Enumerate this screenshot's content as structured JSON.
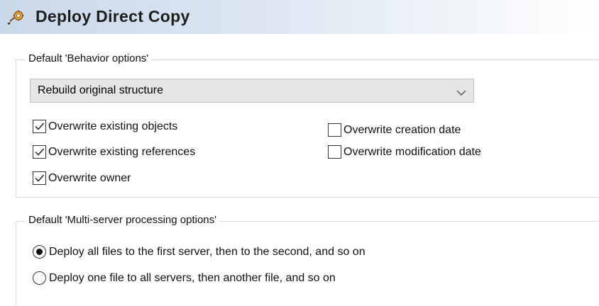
{
  "header": {
    "title": "Deploy Direct Copy",
    "icon": "deploy-icon"
  },
  "behavior": {
    "legend": "Default 'Behavior options'",
    "dropdown": {
      "value": "Rebuild original structure"
    },
    "options": [
      {
        "label": "Overwrite existing objects",
        "checked": true
      },
      {
        "label": "Overwrite existing references",
        "checked": true
      },
      {
        "label": "Overwrite owner",
        "checked": true
      },
      {
        "label": "Overwrite creation date",
        "checked": false
      },
      {
        "label": "Overwrite modification date",
        "checked": false
      }
    ]
  },
  "multiserver": {
    "legend": "Default 'Multi-server processing options'",
    "options": [
      {
        "label": "Deploy all files to the first server, then to the second, and so on",
        "selected": true
      },
      {
        "label": "Deploy one file to all servers, then another file, and so on",
        "selected": false
      }
    ]
  }
}
